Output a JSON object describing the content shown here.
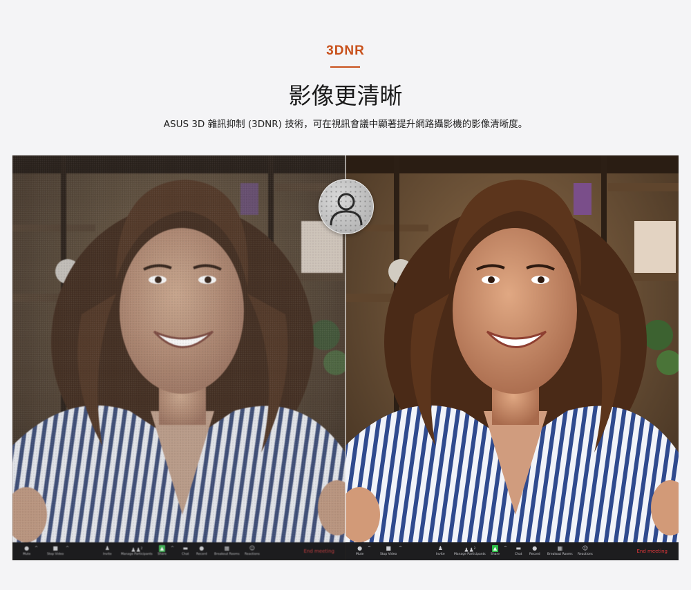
{
  "section": {
    "eyebrow": "3DNR",
    "headline": "影像更清晰",
    "subtitle": "ASUS 3D 雜訊抑制 (3DNR) 技術，可在視訊會議中顯著提升網路攝影機的影像清晰度。",
    "accent_color": "#c8501a"
  },
  "compare": {
    "handle_icon": "person-icon",
    "panels": [
      {
        "id": "before",
        "toolbar": {
          "mute": "Mute",
          "stop_video": "Stop Video",
          "invite": "Invite",
          "manage_participants": "Manage Participants",
          "participants_count": "2",
          "share": "Share",
          "chat": "Chat",
          "record": "Record",
          "breakout_rooms": "Breakout Rooms",
          "reactions": "Reactions",
          "end_meeting": "End meeting"
        }
      },
      {
        "id": "after",
        "toolbar": {
          "mute": "Mute",
          "stop_video": "Stop Video",
          "invite": "Invite",
          "manage_participants": "Manage Participants",
          "participants_count": "2",
          "share": "Share",
          "chat": "Chat",
          "record": "Record",
          "breakout_rooms": "Breakout Rooms",
          "reactions": "Reactions",
          "end_meeting": "End meeting"
        }
      }
    ],
    "end_meeting_color": "#e5383b",
    "share_color": "#2dbd47"
  }
}
